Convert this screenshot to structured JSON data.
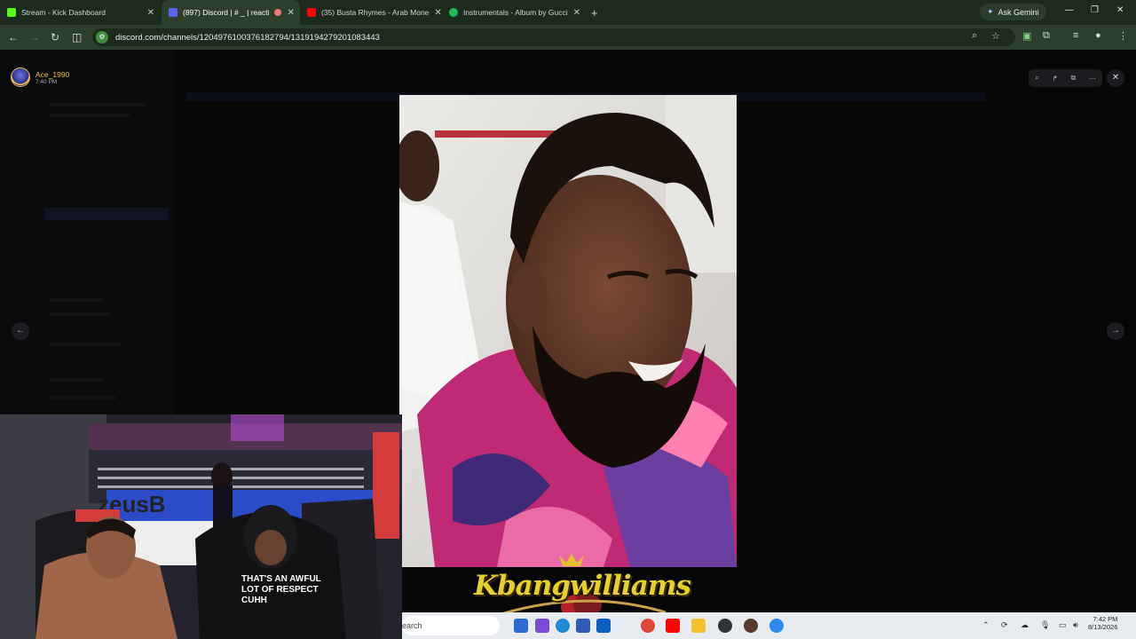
{
  "browser": {
    "tabs": [
      {
        "title": "Stream - Kick Dashboard",
        "favicon_color": "#53fc18"
      },
      {
        "title": "(897) Discord | # _ | reacti",
        "favicon_color": "#5865f2",
        "active": true
      },
      {
        "title": "(35) Busta Rhymes - Arab Mone",
        "favicon_color": "#ff0000"
      },
      {
        "title": "Instrumentals - Album by Gucci",
        "favicon_color": "#1db954"
      }
    ],
    "new_tab": "+",
    "ask_gemini": "Ask Gemini",
    "url": "discord.com/channels/1204976100376182794/1319194279201083443"
  },
  "viewer": {
    "username": "Ace_1990",
    "post_time": "7:40 PM"
  },
  "webcam_shirt_text": "THAT'S AN AWFUL LOT OF RESPECT CUHH",
  "logo_text": "Kbangwilliams",
  "taskbar": {
    "search_label": "earch",
    "time": "7:42 PM",
    "date": "8/13/2026"
  },
  "colors": {
    "chrome_frame": "#1c2b1c",
    "chrome_toolbar": "#2d3e2d",
    "discord_username": "#f3c04a",
    "taskbar": "#e8ebf0"
  }
}
